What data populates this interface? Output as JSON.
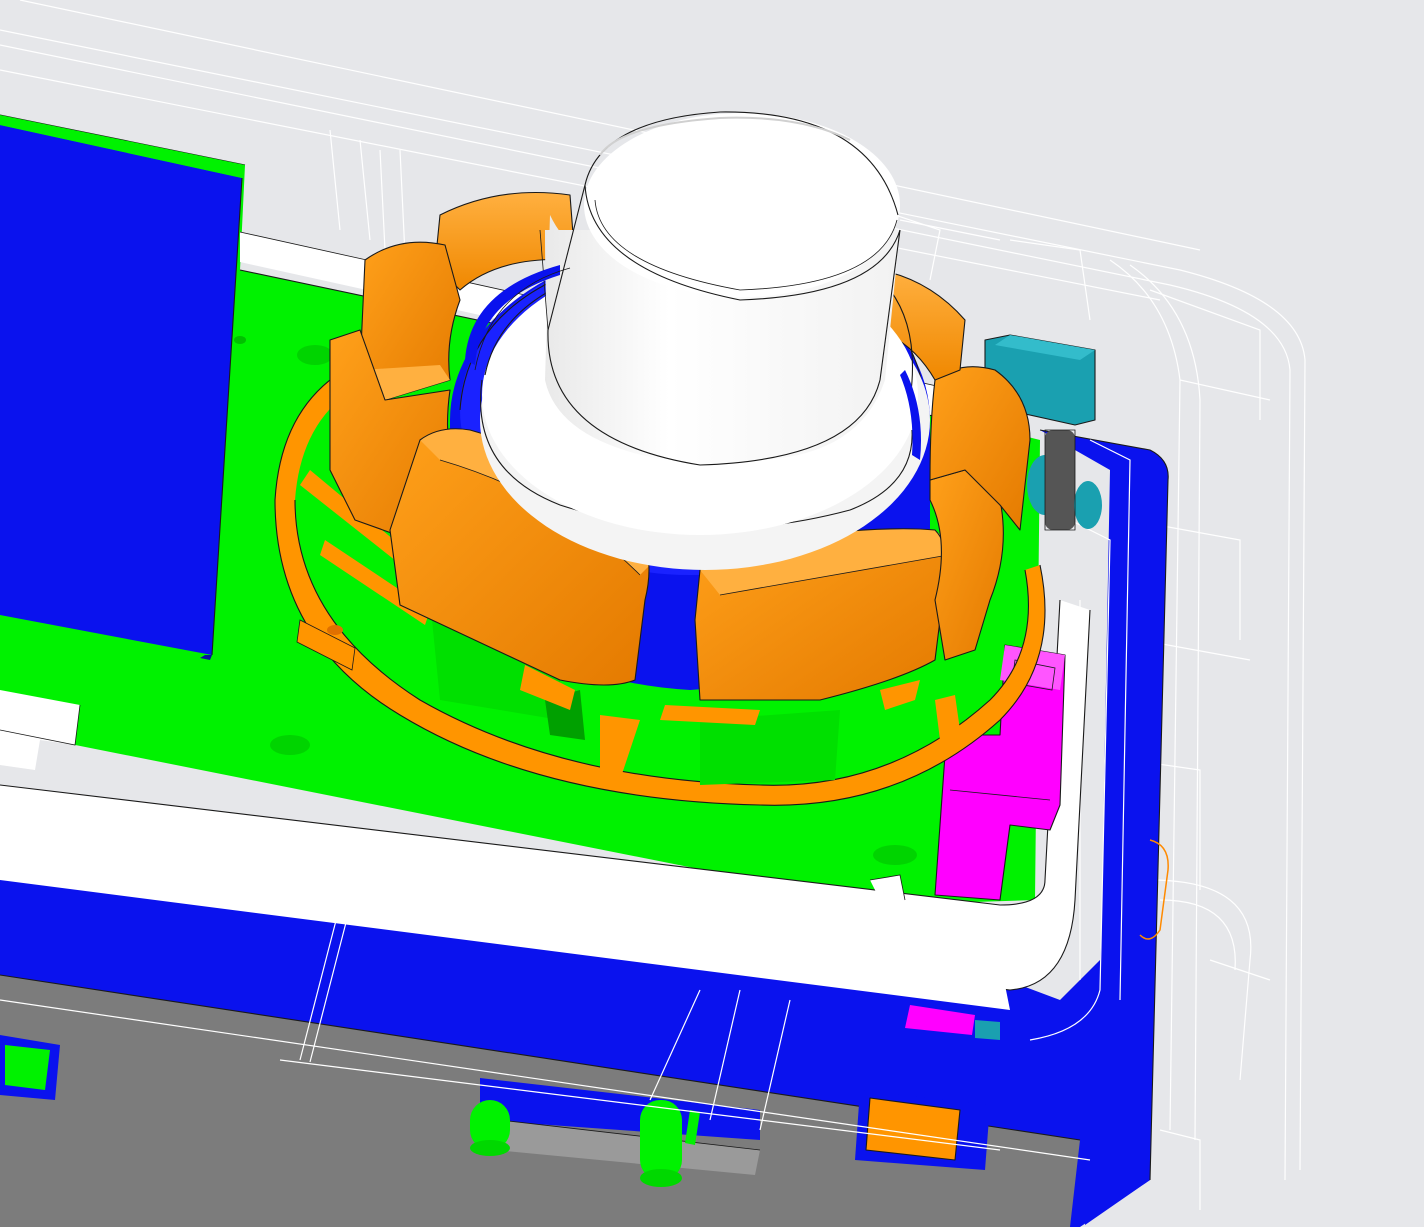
{
  "viewport": {
    "background": "#e6e7ea",
    "colors": {
      "enclosure_blue": "#0a12ee",
      "pcb_green": "#00f200",
      "ring_orange": "#ff9500",
      "ring_orange_dark": "#e67e00",
      "button_white": "#ffffff",
      "button_shade": "#d8d8d8",
      "magenta_part": "#ff00ff",
      "teal_part": "#1aa0b0",
      "base_gray": "#7c7c7c",
      "wireframe": "#ffffff",
      "edge_line": "#1a1a1a"
    }
  },
  "parts": [
    {
      "name": "transparent-housing",
      "style": "wireframe"
    },
    {
      "name": "blue-enclosure",
      "color": "#0a12ee"
    },
    {
      "name": "green-pcb",
      "color": "#00f200"
    },
    {
      "name": "display-module",
      "color": "#0a12ee"
    },
    {
      "name": "orange-segment-ring",
      "color": "#ff9500",
      "segments": 8
    },
    {
      "name": "blue-knob-base",
      "color": "#0a12ee"
    },
    {
      "name": "white-push-button",
      "color": "#ffffff"
    },
    {
      "name": "white-frame",
      "color": "#ffffff"
    },
    {
      "name": "magenta-light-pipe",
      "color": "#ff00ff"
    },
    {
      "name": "teal-connector",
      "color": "#1aa0b0"
    },
    {
      "name": "gray-base-plate",
      "color": "#7c7c7c"
    },
    {
      "name": "green-pin-contacts",
      "color": "#00f200",
      "count": 2
    },
    {
      "name": "orange-block",
      "color": "#ff9500"
    }
  ]
}
